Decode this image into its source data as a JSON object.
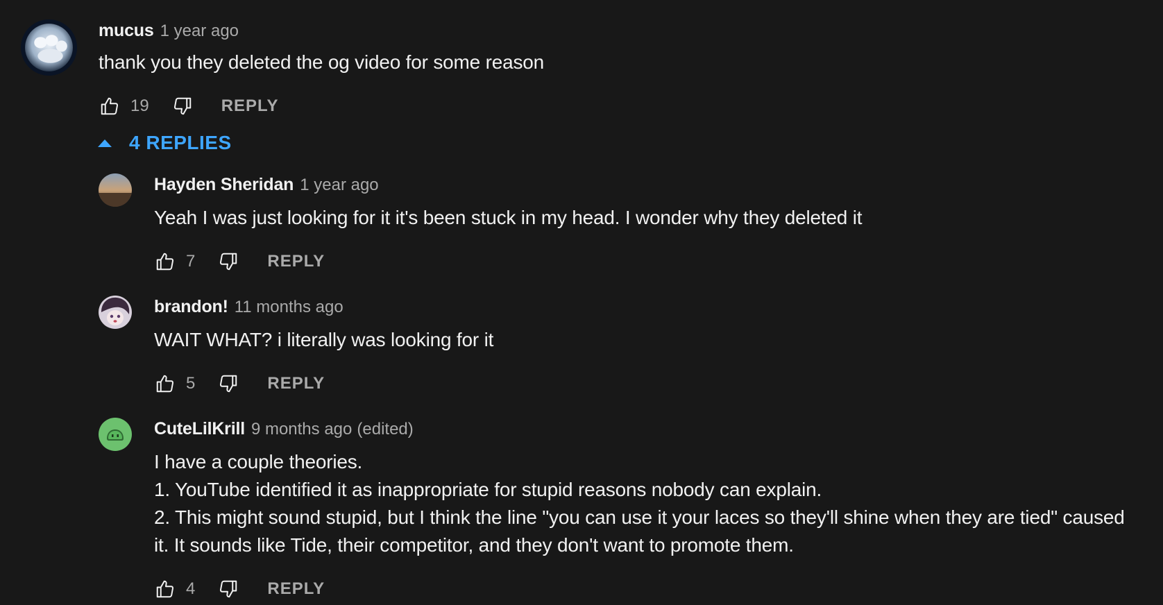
{
  "comment": {
    "author": "mucus",
    "time": "1 year ago",
    "lines": [
      "thank you they deleted the og video for some reason"
    ],
    "likes": "19",
    "reply_label": "REPLY"
  },
  "replies_toggle": {
    "label": "4 REPLIES"
  },
  "replies": [
    {
      "author": "Hayden Sheridan",
      "time": "1 year ago",
      "lines": [
        "Yeah I was just looking for it it's been stuck in my head. I wonder why they deleted it"
      ],
      "likes": "7",
      "reply_label": "REPLY"
    },
    {
      "author": "brandon!",
      "time": "11 months ago",
      "lines": [
        "WAIT WHAT? i literally was looking for it"
      ],
      "likes": "5",
      "reply_label": "REPLY"
    },
    {
      "author": "CuteLilKrill",
      "time": "9 months ago",
      "edited": "(edited)",
      "lines": [
        "I have a couple theories.",
        "1. YouTube identified it as inappropriate for stupid reasons nobody can explain.",
        "2. This might sound stupid, but I think the line \"you can use it your laces so they'll shine when they are tied\" caused",
        "it. It sounds like Tide, their competitor, and they don't want to promote them."
      ],
      "likes": "4",
      "reply_label": "REPLY"
    }
  ],
  "icons": {
    "like": "thumbs-up-icon",
    "dislike": "thumbs-down-icon",
    "toggle": "caret-up-icon"
  },
  "colors": {
    "background": "#181818",
    "text": "#f1f1f1",
    "secondary": "#aaaaaa",
    "accent": "#3ea6ff",
    "avatar_krill": "#6cc16e"
  }
}
